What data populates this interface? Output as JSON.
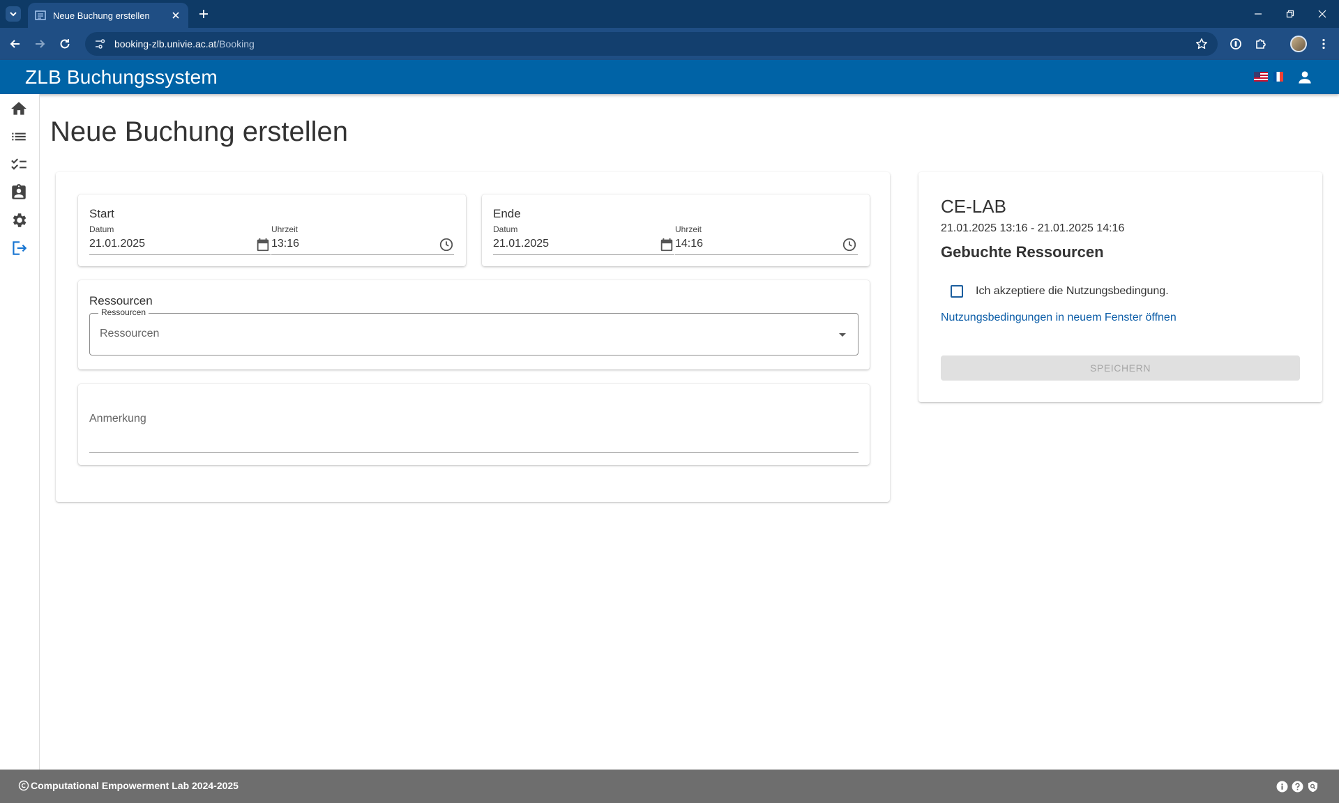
{
  "browser": {
    "tab_title": "Neue Buchung erstellen",
    "url_host": "booking-zlb.univie.ac.at",
    "url_path": "/Booking"
  },
  "app": {
    "title": "ZLB Buchungssystem"
  },
  "sidebar": {
    "items": [
      {
        "icon": "home-icon"
      },
      {
        "icon": "list-icon"
      },
      {
        "icon": "checklist-icon"
      },
      {
        "icon": "assignment-icon"
      },
      {
        "icon": "gear-icon"
      },
      {
        "icon": "logout-icon",
        "active": true
      }
    ]
  },
  "page": {
    "title": "Neue Buchung erstellen"
  },
  "booking": {
    "start": {
      "label": "Start",
      "date_label": "Datum",
      "date_value": "21.01.2025",
      "time_label": "Uhrzeit",
      "time_value": "13:16"
    },
    "end": {
      "label": "Ende",
      "date_label": "Datum",
      "date_value": "21.01.2025",
      "time_label": "Uhrzeit",
      "time_value": "14:16"
    },
    "resources": {
      "label": "Ressourcen",
      "field_legend": "Ressourcen",
      "placeholder": "Ressourcen"
    },
    "note": {
      "placeholder": "Anmerkung"
    }
  },
  "summary": {
    "lab": "CE-LAB",
    "range": "21.01.2025 13:16 - 21.01.2025 14:16",
    "resources_title": "Gebuchte Ressourcen",
    "accept_label": "Ich akzeptiere die Nutzungsbedingung.",
    "terms_link": "Nutzungsbedingungen in neuem Fenster öffnen",
    "save_label": "SPEICHERN"
  },
  "footer": {
    "copyright": "Computational Empowerment Lab 2024-2025"
  },
  "colors": {
    "brand": "#0063a6",
    "browser_chrome": "#1f4e84",
    "link": "#0d5ea8",
    "footer": "#6e6e6e"
  }
}
